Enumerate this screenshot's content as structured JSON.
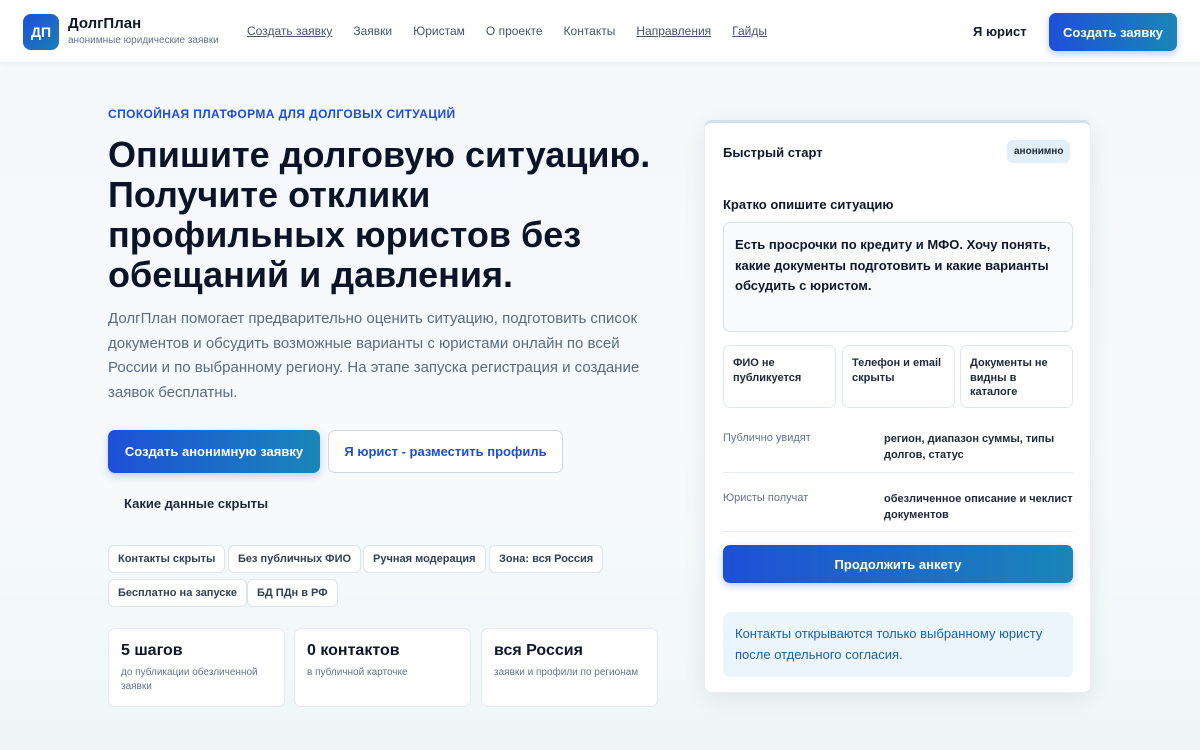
{
  "header": {
    "logo_text": "ДП",
    "brand_name": "ДолгПлан",
    "brand_sub": "анонимные юридические заявки",
    "nav": [
      {
        "label": "Создать заявку",
        "underline": true
      },
      {
        "label": "Заявки",
        "underline": false
      },
      {
        "label": "Юристам",
        "underline": false
      },
      {
        "label": "О проекте",
        "underline": false
      },
      {
        "label": "Контакты",
        "underline": false
      },
      {
        "label": "Направления",
        "underline": true
      },
      {
        "label": "Гайды",
        "underline": true
      }
    ],
    "lawyer_link": "Я юрист",
    "cta": "Создать заявку"
  },
  "hero": {
    "eyebrow": "СПОКОЙНАЯ ПЛАТФОРМА ДЛЯ ДОЛГОВЫХ СИТУАЦИЙ",
    "title": "Опишите долговую ситуацию. Получите отклики профильных юристов без обещаний и давления.",
    "description": "ДолгПлан помогает предварительно оценить ситуацию, подготовить список документов и обсудить возможные варианты с юристами онлайн по всей России и по выбранному региону. На этапе запуска регистрация и создание заявок бесплатны.",
    "btn_primary": "Создать анонимную заявку",
    "btn_outline": "Я юрист - разместить профиль",
    "link_hidden": "Какие данные скрыты",
    "chips": [
      "Контакты скрыты",
      "Без публичных ФИО",
      "Ручная модерация",
      "Зона: вся Россия",
      "Бесплатно на запуске",
      "БД ПДн в РФ"
    ],
    "stats": [
      {
        "value": "5 шагов",
        "label": "до публикации обезличенной заявки"
      },
      {
        "value": "0 контактов",
        "label": "в публичной карточке"
      },
      {
        "value": "вся Россия",
        "label": "заявки и профили по регионам"
      }
    ]
  },
  "card": {
    "title": "Быстрый старт",
    "badge": "анонимно",
    "field_label": "Кратко опишите ситуацию",
    "textarea_value": "Есть просрочки по кредиту и МФО. Хочу понять, какие документы подготовить и какие варианты обсудить с юристом.",
    "features": [
      "ФИО не публикуется",
      "Телефон и email скрыты",
      "Документы не видны в каталоге"
    ],
    "rows": [
      {
        "label": "Публично увидят",
        "value": "регион, диапазон суммы, типы долгов, статус"
      },
      {
        "label": "Юристы получат",
        "value": "обезличенное описание и чеклист документов"
      }
    ],
    "continue_btn": "Продолжить анкету",
    "note": "Контакты открываются только выбранному юристу после отдельного согласия."
  }
}
